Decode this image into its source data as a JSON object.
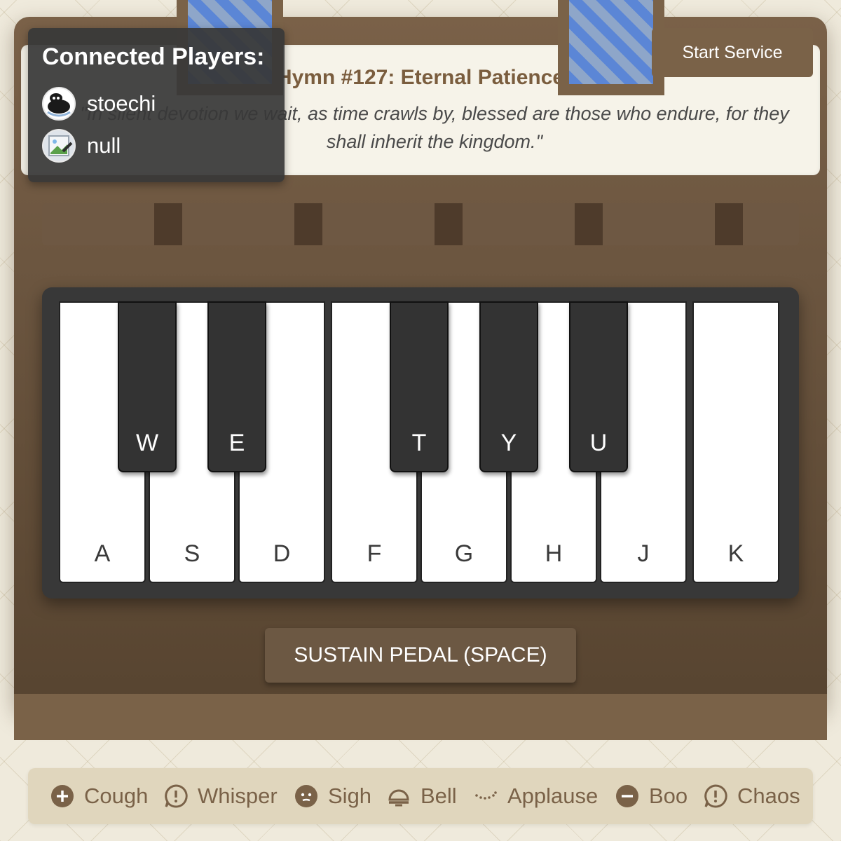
{
  "header": {
    "start_button": "Start Service"
  },
  "hymn": {
    "title": "Hymn #127: Eternal Patience",
    "verse": "\"In silent devotion we wait, as time crawls by, blessed are those who endure, for they shall inherit the kingdom.\""
  },
  "players": {
    "title": "Connected Players:",
    "list": [
      {
        "name": "stoechi",
        "avatar": "avatar-image-icon"
      },
      {
        "name": "null",
        "avatar": "broken-image-icon"
      }
    ]
  },
  "keyboard": {
    "white_keys": [
      "A",
      "S",
      "D",
      "F",
      "G",
      "H",
      "J",
      "K"
    ],
    "black_keys": [
      "W",
      "E",
      "T",
      "Y",
      "U"
    ]
  },
  "pedal": {
    "label": "SUSTAIN PEDAL (SPACE)"
  },
  "sounds": [
    {
      "label": "Cough",
      "icon": "plus-circle-icon"
    },
    {
      "label": "Whisper",
      "icon": "exclamation-bubble-icon"
    },
    {
      "label": "Sigh",
      "icon": "face-icon"
    },
    {
      "label": "Bell",
      "icon": "bell-icon"
    },
    {
      "label": "Applause",
      "icon": "dots-icon"
    },
    {
      "label": "Boo",
      "icon": "minus-circle-icon"
    },
    {
      "label": "Chaos",
      "icon": "exclamation-bubble-icon"
    }
  ],
  "colors": {
    "wood": "#7a6248",
    "accent_text": "#7a5d3e",
    "key_black": "#333333",
    "key_white": "#ffffff",
    "glass_blue": "#5b86d6"
  }
}
